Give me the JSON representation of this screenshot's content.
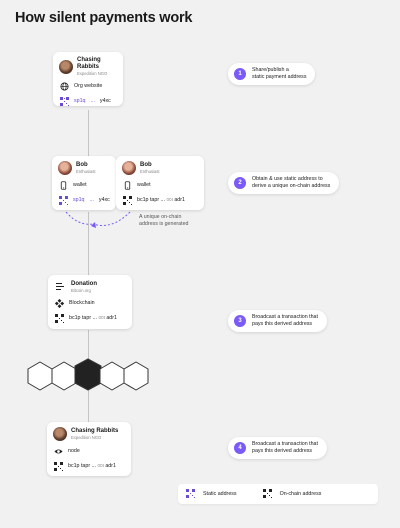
{
  "title": "How silent payments work",
  "colors": {
    "accent": "#7a5af8",
    "static_address": "#6a4ad6",
    "background": "#f1f1f1"
  },
  "card_publish": {
    "name": "Chasing Rabbits",
    "sub": "Expedition NGO",
    "row1_icon": "globe-icon",
    "row1_text": "Org website",
    "addr_a": "sp1q",
    "addr_b": "...",
    "addr_c": "y4xc"
  },
  "card_bob_left": {
    "name": "Bob",
    "sub": "Enthusiast",
    "row1_icon": "phone-icon",
    "row1_text": "wallet",
    "addr_a": "sp1q",
    "addr_b": "...",
    "addr_c": "y4xc"
  },
  "card_bob_right": {
    "name": "Bob",
    "sub": "Enthusiast",
    "row1_icon": "phone-icon",
    "row1_text": "wallet",
    "addr_a": "bc1p tapr",
    "addr_b": "...",
    "addr_mid": "00t",
    "addr_c": "adr1"
  },
  "generated_note": [
    "A unique on-chain",
    "address is generated"
  ],
  "card_donation": {
    "name": "Donation",
    "sub": "Bitcoin.org",
    "row1_icon": "blockchain-icon",
    "row1_text": "Blockchain",
    "addr_a": "bc1p tapr",
    "addr_b": "...",
    "addr_mid": "00t",
    "addr_c": "adr1"
  },
  "card_node": {
    "name": "Chasing Rabbits",
    "sub": "Expedition NGO",
    "row1_icon": "eye-icon",
    "row1_text": "node",
    "addr_a": "bc1p tapr",
    "addr_b": "...",
    "addr_mid": "00t",
    "addr_c": "adr1"
  },
  "steps": [
    {
      "num": "1",
      "line1": "Share/publish a",
      "line2": "static payment address"
    },
    {
      "num": "2",
      "line1": "Obtain & use static address to",
      "line2": "derive a unique on-chain address"
    },
    {
      "num": "3",
      "line1": "Broadcast a transaction that",
      "line2": "pays this derived address"
    },
    {
      "num": "4",
      "line1": "Broadcast a transaction that",
      "line2": "pays this derived address"
    }
  ],
  "legend": {
    "static_label": "Static address",
    "onchain_label": "On-chain address"
  }
}
